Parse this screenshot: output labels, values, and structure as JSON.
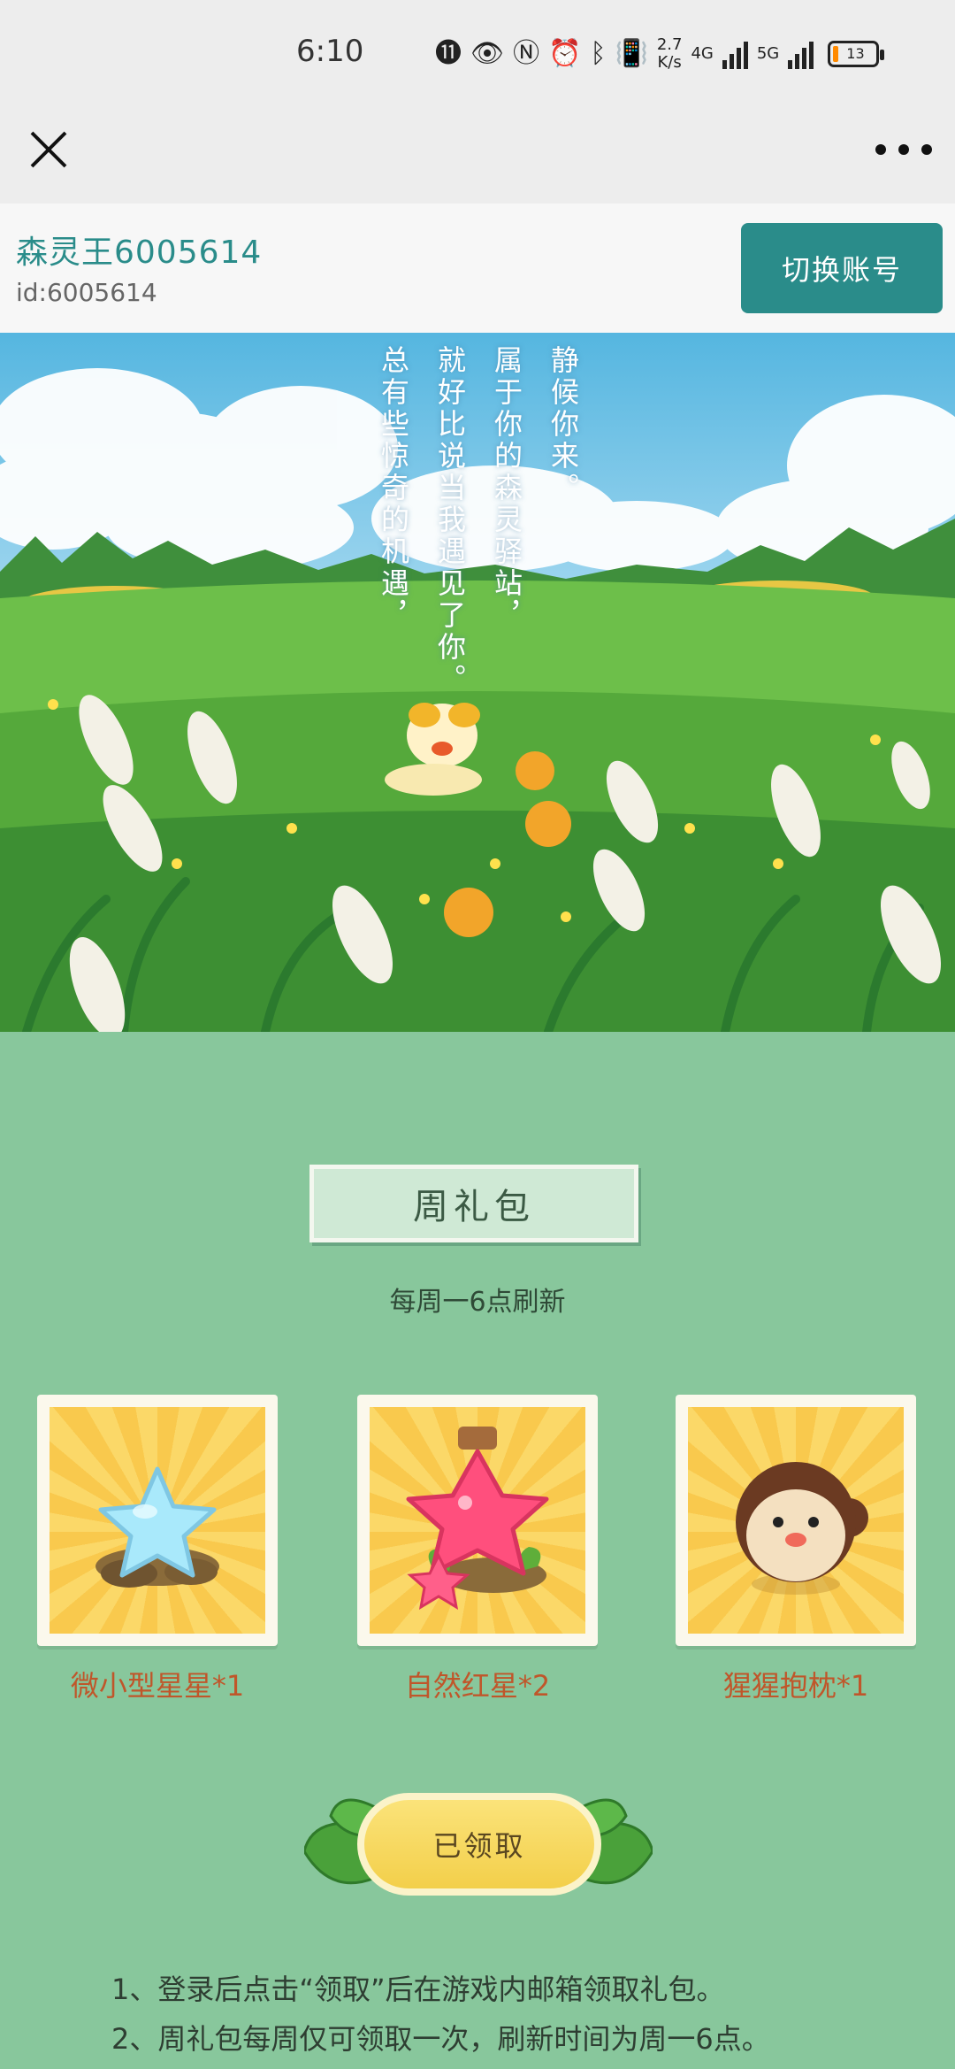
{
  "status_bar": {
    "time": "6:10",
    "net_speed_value": "2.7",
    "net_speed_unit": "K/s",
    "signal1_label": "4G",
    "signal2_label": "5G",
    "battery_level": "13",
    "battery_fraction": 0.13
  },
  "account": {
    "name": "森灵王6005614",
    "id": "id:6005614",
    "switch_label": "切换账号"
  },
  "hero": {
    "poem_lines": [
      "静候你来。",
      "属于你的森灵驿站，",
      "就好比说当我遇见了你。",
      "总有些惊奇的机遇，"
    ]
  },
  "gift": {
    "title": "周礼包",
    "subtitle": "每周一6点刷新",
    "items": [
      {
        "label": "微小型星星*1",
        "icon": "blue-star-icon"
      },
      {
        "label": "自然红星*2",
        "icon": "red-star-bottle-icon"
      },
      {
        "label": "猩猩抱枕*1",
        "icon": "monkey-pillow-icon"
      }
    ],
    "claim_label": "已领取"
  },
  "rules": [
    "1、登录后点击“领取”后在游戏内邮箱领取礼包。",
    "2、周礼包每周仅可领取一次，刷新时间为周一6点。"
  ],
  "colors": {
    "accent": "#2a8c8a",
    "page_bg": "#88c79c",
    "label_orange": "#c0562a",
    "button_yellow": "#f3cf4a"
  }
}
